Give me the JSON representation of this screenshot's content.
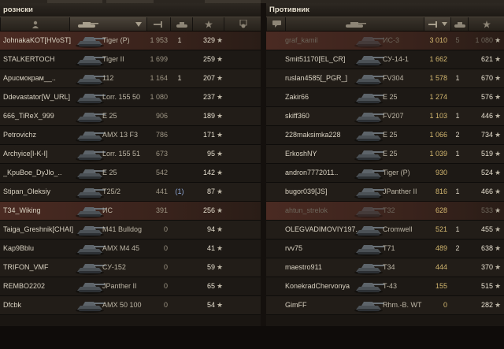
{
  "left_team": {
    "title": "рознски",
    "rows": [
      {
        "name": "JohnakaKOT[HVoST]",
        "vehicle": "Tiger (P)",
        "damage": "1 953",
        "frags": "1",
        "xp": "329",
        "highlight": true,
        "dead": false,
        "assist": false
      },
      {
        "name": "STALKERTOCH",
        "vehicle": "Tiger II",
        "damage": "1 699",
        "frags": "",
        "xp": "259",
        "highlight": false,
        "dead": false,
        "assist": false
      },
      {
        "name": "Apucмокрам__..",
        "vehicle": "112",
        "damage": "1 164",
        "frags": "1",
        "xp": "207",
        "highlight": false,
        "dead": false,
        "assist": false
      },
      {
        "name": "Ddevastator[W_URL]",
        "vehicle": "Lorr. 155 50",
        "damage": "1 080",
        "frags": "",
        "xp": "237",
        "highlight": false,
        "dead": false,
        "assist": false
      },
      {
        "name": "666_TiReX_999",
        "vehicle": "E 25",
        "damage": "906",
        "frags": "",
        "xp": "189",
        "highlight": false,
        "dead": false,
        "assist": false
      },
      {
        "name": "Petrovichz",
        "vehicle": "AMX 13 F3",
        "damage": "786",
        "frags": "",
        "xp": "171",
        "highlight": false,
        "dead": false,
        "assist": false
      },
      {
        "name": "Archyice[I-K-I]",
        "vehicle": "Lorr. 155 51",
        "damage": "673",
        "frags": "",
        "xp": "95",
        "highlight": false,
        "dead": false,
        "assist": false
      },
      {
        "name": "_KpuBoe_DyJlo_..",
        "vehicle": "E 25",
        "damage": "542",
        "frags": "",
        "xp": "142",
        "highlight": false,
        "dead": false,
        "assist": false
      },
      {
        "name": "Stipan_Oleksiy",
        "vehicle": "T25/2",
        "damage": "441",
        "frags": "(1)",
        "xp": "87",
        "highlight": false,
        "dead": false,
        "assist": true
      },
      {
        "name": "T34_Wiking",
        "vehicle": "ИС",
        "damage": "391",
        "frags": "",
        "xp": "256",
        "highlight": true,
        "dead": false,
        "assist": false
      },
      {
        "name": "Taiga_Greshnik[CHAI]",
        "vehicle": "M41 Bulldog",
        "damage": "0",
        "frags": "",
        "xp": "94",
        "highlight": false,
        "dead": false,
        "assist": false
      },
      {
        "name": "Kap9Bblu",
        "vehicle": "AMX M4 45",
        "damage": "0",
        "frags": "",
        "xp": "41",
        "highlight": false,
        "dead": false,
        "assist": false
      },
      {
        "name": "TRIFON_VMF",
        "vehicle": "СУ-152",
        "damage": "0",
        "frags": "",
        "xp": "59",
        "highlight": false,
        "dead": false,
        "assist": false
      },
      {
        "name": "REMBO2202",
        "vehicle": "JPanther II",
        "damage": "0",
        "frags": "",
        "xp": "65",
        "highlight": false,
        "dead": false,
        "assist": false
      },
      {
        "name": "Dfcbk",
        "vehicle": "AMX 50 100",
        "damage": "0",
        "frags": "",
        "xp": "54",
        "highlight": false,
        "dead": false,
        "assist": false
      }
    ]
  },
  "right_team": {
    "title": "Противник",
    "rows": [
      {
        "name": "graf_kamil",
        "vehicle": "ИС-3",
        "damage": "3 010",
        "frags": "5",
        "xp": "1 080",
        "highlight": true,
        "dead": true,
        "assist": false
      },
      {
        "name": "Smit51170[EL_CR]",
        "vehicle": "СУ-14-1",
        "damage": "1 662",
        "frags": "",
        "xp": "621",
        "highlight": false,
        "dead": false,
        "assist": false
      },
      {
        "name": "ruslan4585[_PGR_]",
        "vehicle": "FV304",
        "damage": "1 578",
        "frags": "1",
        "xp": "670",
        "highlight": false,
        "dead": false,
        "assist": false
      },
      {
        "name": "Zakir66",
        "vehicle": "E 25",
        "damage": "1 274",
        "frags": "",
        "xp": "576",
        "highlight": false,
        "dead": false,
        "assist": false
      },
      {
        "name": "skiff360",
        "vehicle": "FV207",
        "damage": "1 103",
        "frags": "1",
        "xp": "446",
        "highlight": false,
        "dead": false,
        "assist": false
      },
      {
        "name": "228maksimka228",
        "vehicle": "E 25",
        "damage": "1 066",
        "frags": "2",
        "xp": "734",
        "highlight": false,
        "dead": false,
        "assist": false
      },
      {
        "name": "ErkoshNY",
        "vehicle": "E 25",
        "damage": "1 039",
        "frags": "1",
        "xp": "519",
        "highlight": false,
        "dead": false,
        "assist": false
      },
      {
        "name": "andron7772011..",
        "vehicle": "Tiger (P)",
        "damage": "930",
        "frags": "",
        "xp": "524",
        "highlight": false,
        "dead": false,
        "assist": false
      },
      {
        "name": "bugor039[JS]",
        "vehicle": "JPanther II",
        "damage": "816",
        "frags": "1",
        "xp": "466",
        "highlight": false,
        "dead": false,
        "assist": false
      },
      {
        "name": "ahtun_strelok",
        "vehicle": "T32",
        "damage": "628",
        "frags": "",
        "xp": "533",
        "highlight": true,
        "dead": true,
        "assist": false
      },
      {
        "name": "OLEGVADIMOVIY197..",
        "vehicle": "Cromwell",
        "damage": "521",
        "frags": "1",
        "xp": "455",
        "highlight": false,
        "dead": false,
        "assist": false
      },
      {
        "name": "rvv75",
        "vehicle": "T71",
        "damage": "489",
        "frags": "2",
        "xp": "638",
        "highlight": false,
        "dead": false,
        "assist": false
      },
      {
        "name": "maestro911",
        "vehicle": "T34",
        "damage": "444",
        "frags": "",
        "xp": "370",
        "highlight": false,
        "dead": false,
        "assist": false
      },
      {
        "name": "KonekradChervonya",
        "vehicle": "T-43",
        "damage": "155",
        "frags": "",
        "xp": "515",
        "highlight": false,
        "dead": false,
        "assist": false
      },
      {
        "name": "GimFF",
        "vehicle": "Rhm.-B. WT",
        "damage": "0",
        "frags": "",
        "xp": "282",
        "highlight": false,
        "dead": false,
        "assist": false
      }
    ]
  },
  "star_glyph": "★",
  "header_icons": [
    "player-icon",
    "tank-icon",
    "damage-icon",
    "frags-icon",
    "xp-star-icon",
    "medal-icon"
  ],
  "colors": {
    "highlight": "#4a2a22",
    "enemy_damage": "#d4b870",
    "assist": "#8fa8d8"
  }
}
